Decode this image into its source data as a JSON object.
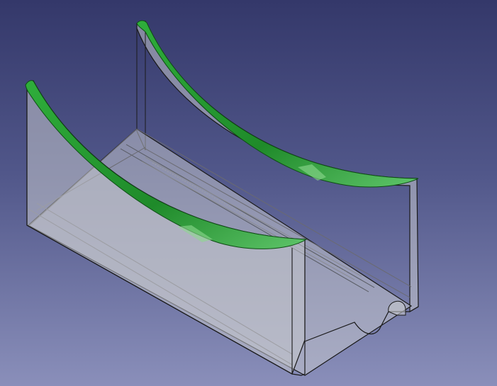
{
  "viewport": {
    "background_top": "#34386a",
    "background_bottom": "#8a8fba",
    "model": {
      "body_fill": "#c4c6cc",
      "body_opacity": 0.55,
      "edge_color": "#1a1a1a",
      "hidden_edge_color": "#6a6a70",
      "selected_face_color": "#1f9a2b",
      "selected_face_light": "#7ad37f"
    }
  }
}
